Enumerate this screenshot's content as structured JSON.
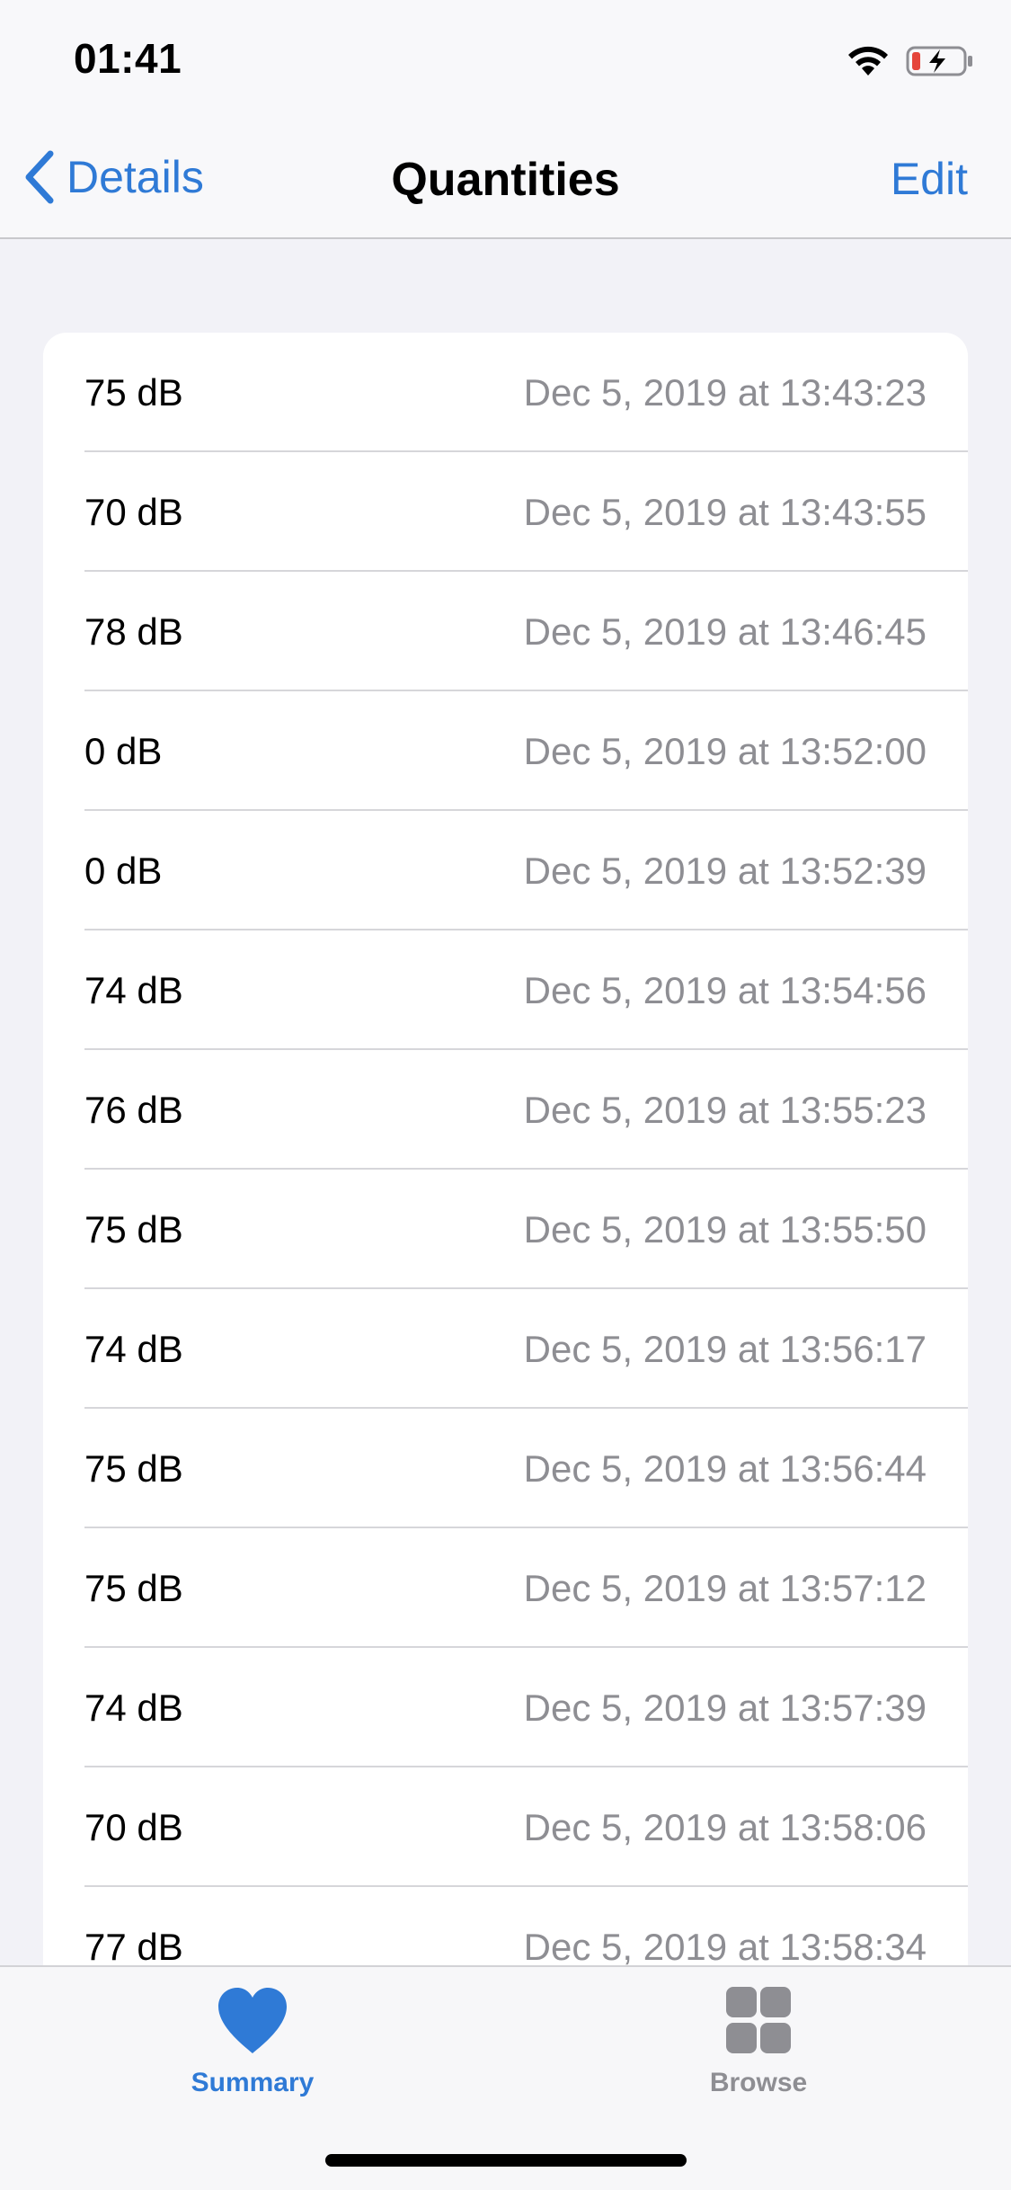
{
  "status_bar": {
    "time": "01:41",
    "icons": [
      "wifi-icon",
      "battery-charging-icon"
    ],
    "battery_color": "#e5453b"
  },
  "nav": {
    "back_label": "Details",
    "title": "Quantities",
    "edit_label": "Edit"
  },
  "rows": [
    {
      "value": "75 dB",
      "date": "Dec 5, 2019 at 13:43:23"
    },
    {
      "value": "70 dB",
      "date": "Dec 5, 2019 at 13:43:55"
    },
    {
      "value": "78 dB",
      "date": "Dec 5, 2019 at 13:46:45"
    },
    {
      "value": "0 dB",
      "date": "Dec 5, 2019 at 13:52:00"
    },
    {
      "value": "0 dB",
      "date": "Dec 5, 2019 at 13:52:39"
    },
    {
      "value": "74 dB",
      "date": "Dec 5, 2019 at 13:54:56"
    },
    {
      "value": "76 dB",
      "date": "Dec 5, 2019 at 13:55:23"
    },
    {
      "value": "75 dB",
      "date": "Dec 5, 2019 at 13:55:50"
    },
    {
      "value": "74 dB",
      "date": "Dec 5, 2019 at 13:56:17"
    },
    {
      "value": "75 dB",
      "date": "Dec 5, 2019 at 13:56:44"
    },
    {
      "value": "75 dB",
      "date": "Dec 5, 2019 at 13:57:12"
    },
    {
      "value": "74 dB",
      "date": "Dec 5, 2019 at 13:57:39"
    },
    {
      "value": "70 dB",
      "date": "Dec 5, 2019 at 13:58:06"
    },
    {
      "value": "77 dB",
      "date": "Dec 5, 2019 at 13:58:34"
    }
  ],
  "tabs": [
    {
      "label": "Summary",
      "icon": "heart-icon",
      "selected": true
    },
    {
      "label": "Browse",
      "icon": "grid-icon",
      "selected": false
    }
  ],
  "colors": {
    "accent": "#2f7ad6",
    "secondary_text": "#8e8e93",
    "background": "#f2f2f7"
  }
}
